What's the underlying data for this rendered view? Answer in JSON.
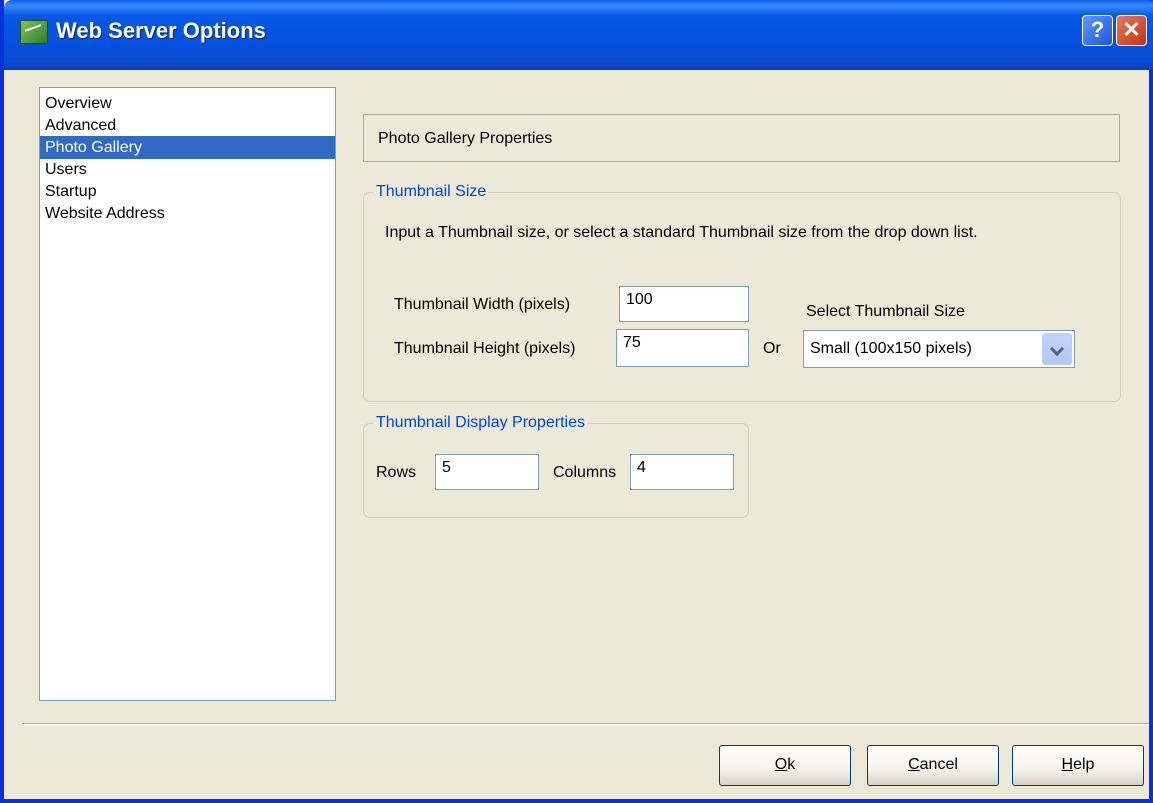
{
  "window": {
    "title": "Web Server Options",
    "help_glyph": "?",
    "close_glyph": "✕"
  },
  "nav": {
    "items": [
      "Overview",
      "Advanced",
      "Photo Gallery",
      "Users",
      "Startup",
      "Website Address"
    ],
    "selected": "Photo Gallery"
  },
  "panel": {
    "header": "Photo Gallery Properties",
    "thumbnail_size": {
      "legend": "Thumbnail Size",
      "instructions": "Input a Thumbnail size, or select a standard Thumbnail size from the drop down list.",
      "width_label": "Thumbnail Width (pixels)",
      "width_value": "100",
      "height_label": "Thumbnail Height (pixels)",
      "height_value": "75",
      "or_label": "Or",
      "select_label": "Select Thumbnail Size",
      "select_value": "Small (100x150 pixels)"
    },
    "display": {
      "legend": "Thumbnail Display Properties",
      "rows_label": "Rows",
      "rows_value": "5",
      "columns_label": "Columns",
      "columns_value": "4"
    }
  },
  "buttons": {
    "ok_accel": "O",
    "ok_rest": "k",
    "cancel_accel": "C",
    "cancel_rest": "ancel",
    "help_accel": "H",
    "help_rest": "elp"
  },
  "colors": {
    "title_bar": "#0758e6",
    "selection": "#316ac5",
    "legend": "#0046d5",
    "dialog_bg": "#ece9d8"
  },
  "icons": [
    "app-icon",
    "help-icon",
    "close-icon",
    "chevron-down-icon"
  ]
}
